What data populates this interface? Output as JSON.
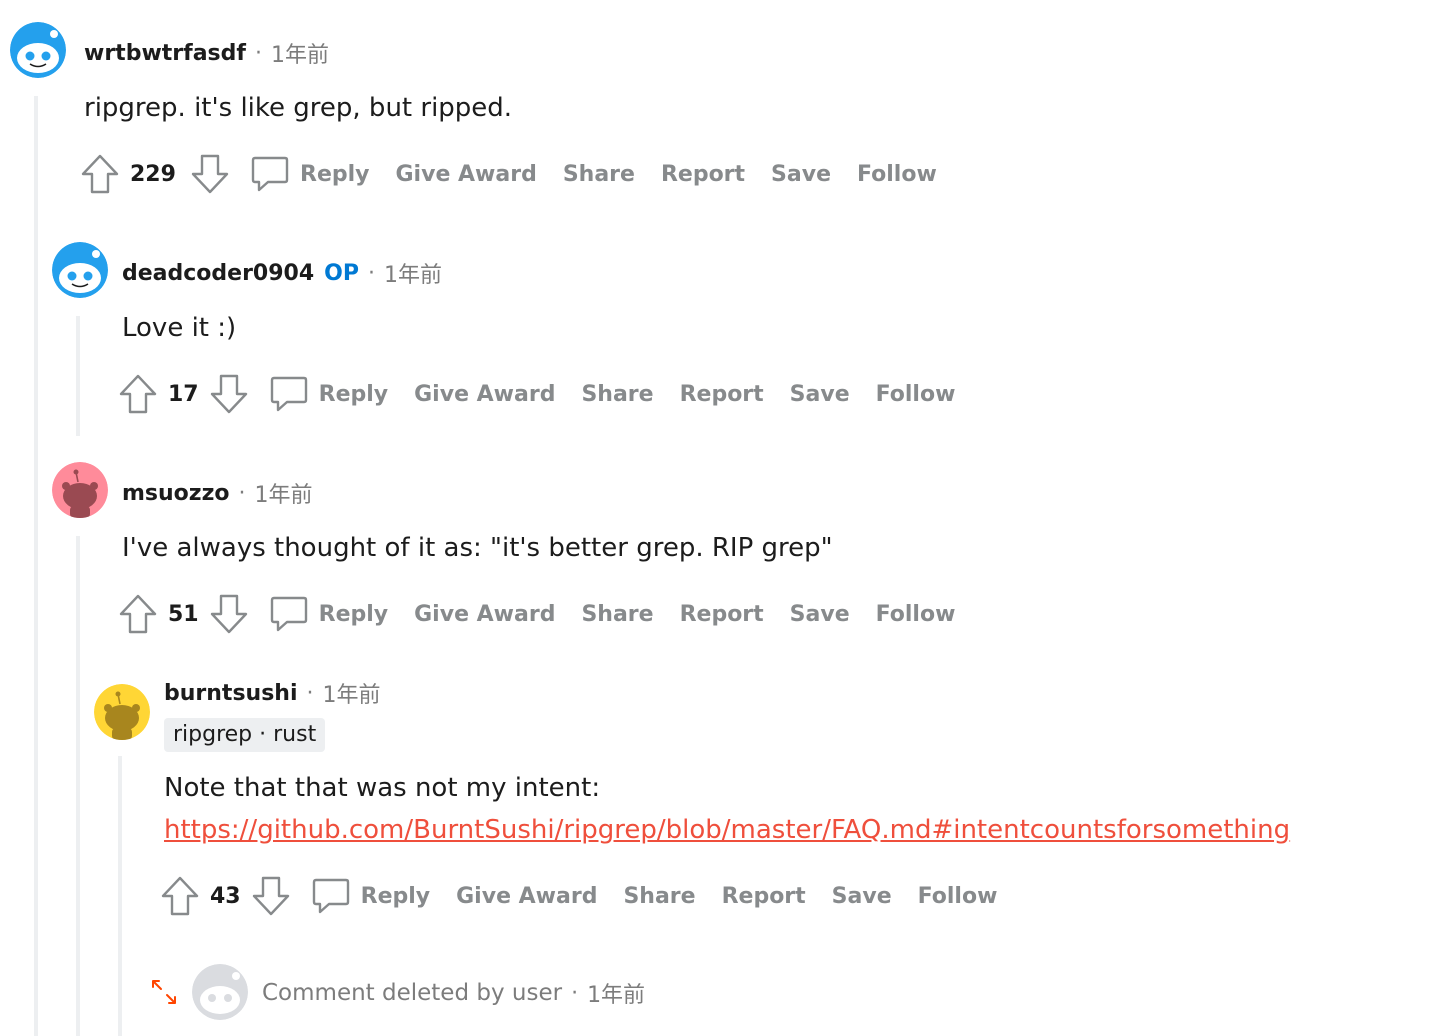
{
  "comments": [
    {
      "username": "wrtbwtrfasdf",
      "time": "1年前",
      "body": "ripgrep. it's like grep, but ripped.",
      "score": "229",
      "avatar_color": "#24a0ed"
    },
    {
      "username": "deadcoder0904",
      "op_label": "OP",
      "time": "1年前",
      "body": "Love it :)",
      "score": "17",
      "avatar_color": "#24a0ed"
    },
    {
      "username": "msuozzo",
      "time": "1年前",
      "body": "I've always thought of it as: \"it's better grep. RIP grep\"",
      "score": "51",
      "avatar_color": "#ff8b9a"
    },
    {
      "username": "burntsushi",
      "time": "1年前",
      "flair": "ripgrep · rust",
      "body": "Note that that was not my intent:",
      "link": "https://github.com/BurntSushi/ripgrep/blob/master/FAQ.md#intentcountsforsomething",
      "score": "43",
      "avatar_color": "#ffd635"
    }
  ],
  "actions": {
    "reply": "Reply",
    "give_award": "Give Award",
    "share": "Share",
    "report": "Report",
    "save": "Save",
    "follow": "Follow"
  },
  "deleted": {
    "text": "Comment deleted by user",
    "time": "1年前"
  },
  "icons": {
    "upvote": "upvote-arrow-icon",
    "downvote": "downvote-arrow-icon",
    "reply": "speech-bubble-icon",
    "expand": "expand-arrows-icon",
    "avatar": "snoo-avatar-icon"
  },
  "colors": {
    "op": "#0079d3",
    "link": "#ef4f3c",
    "muted": "#878a8c",
    "thread_line": "#edeff1",
    "expand_icon": "#ff4500"
  }
}
